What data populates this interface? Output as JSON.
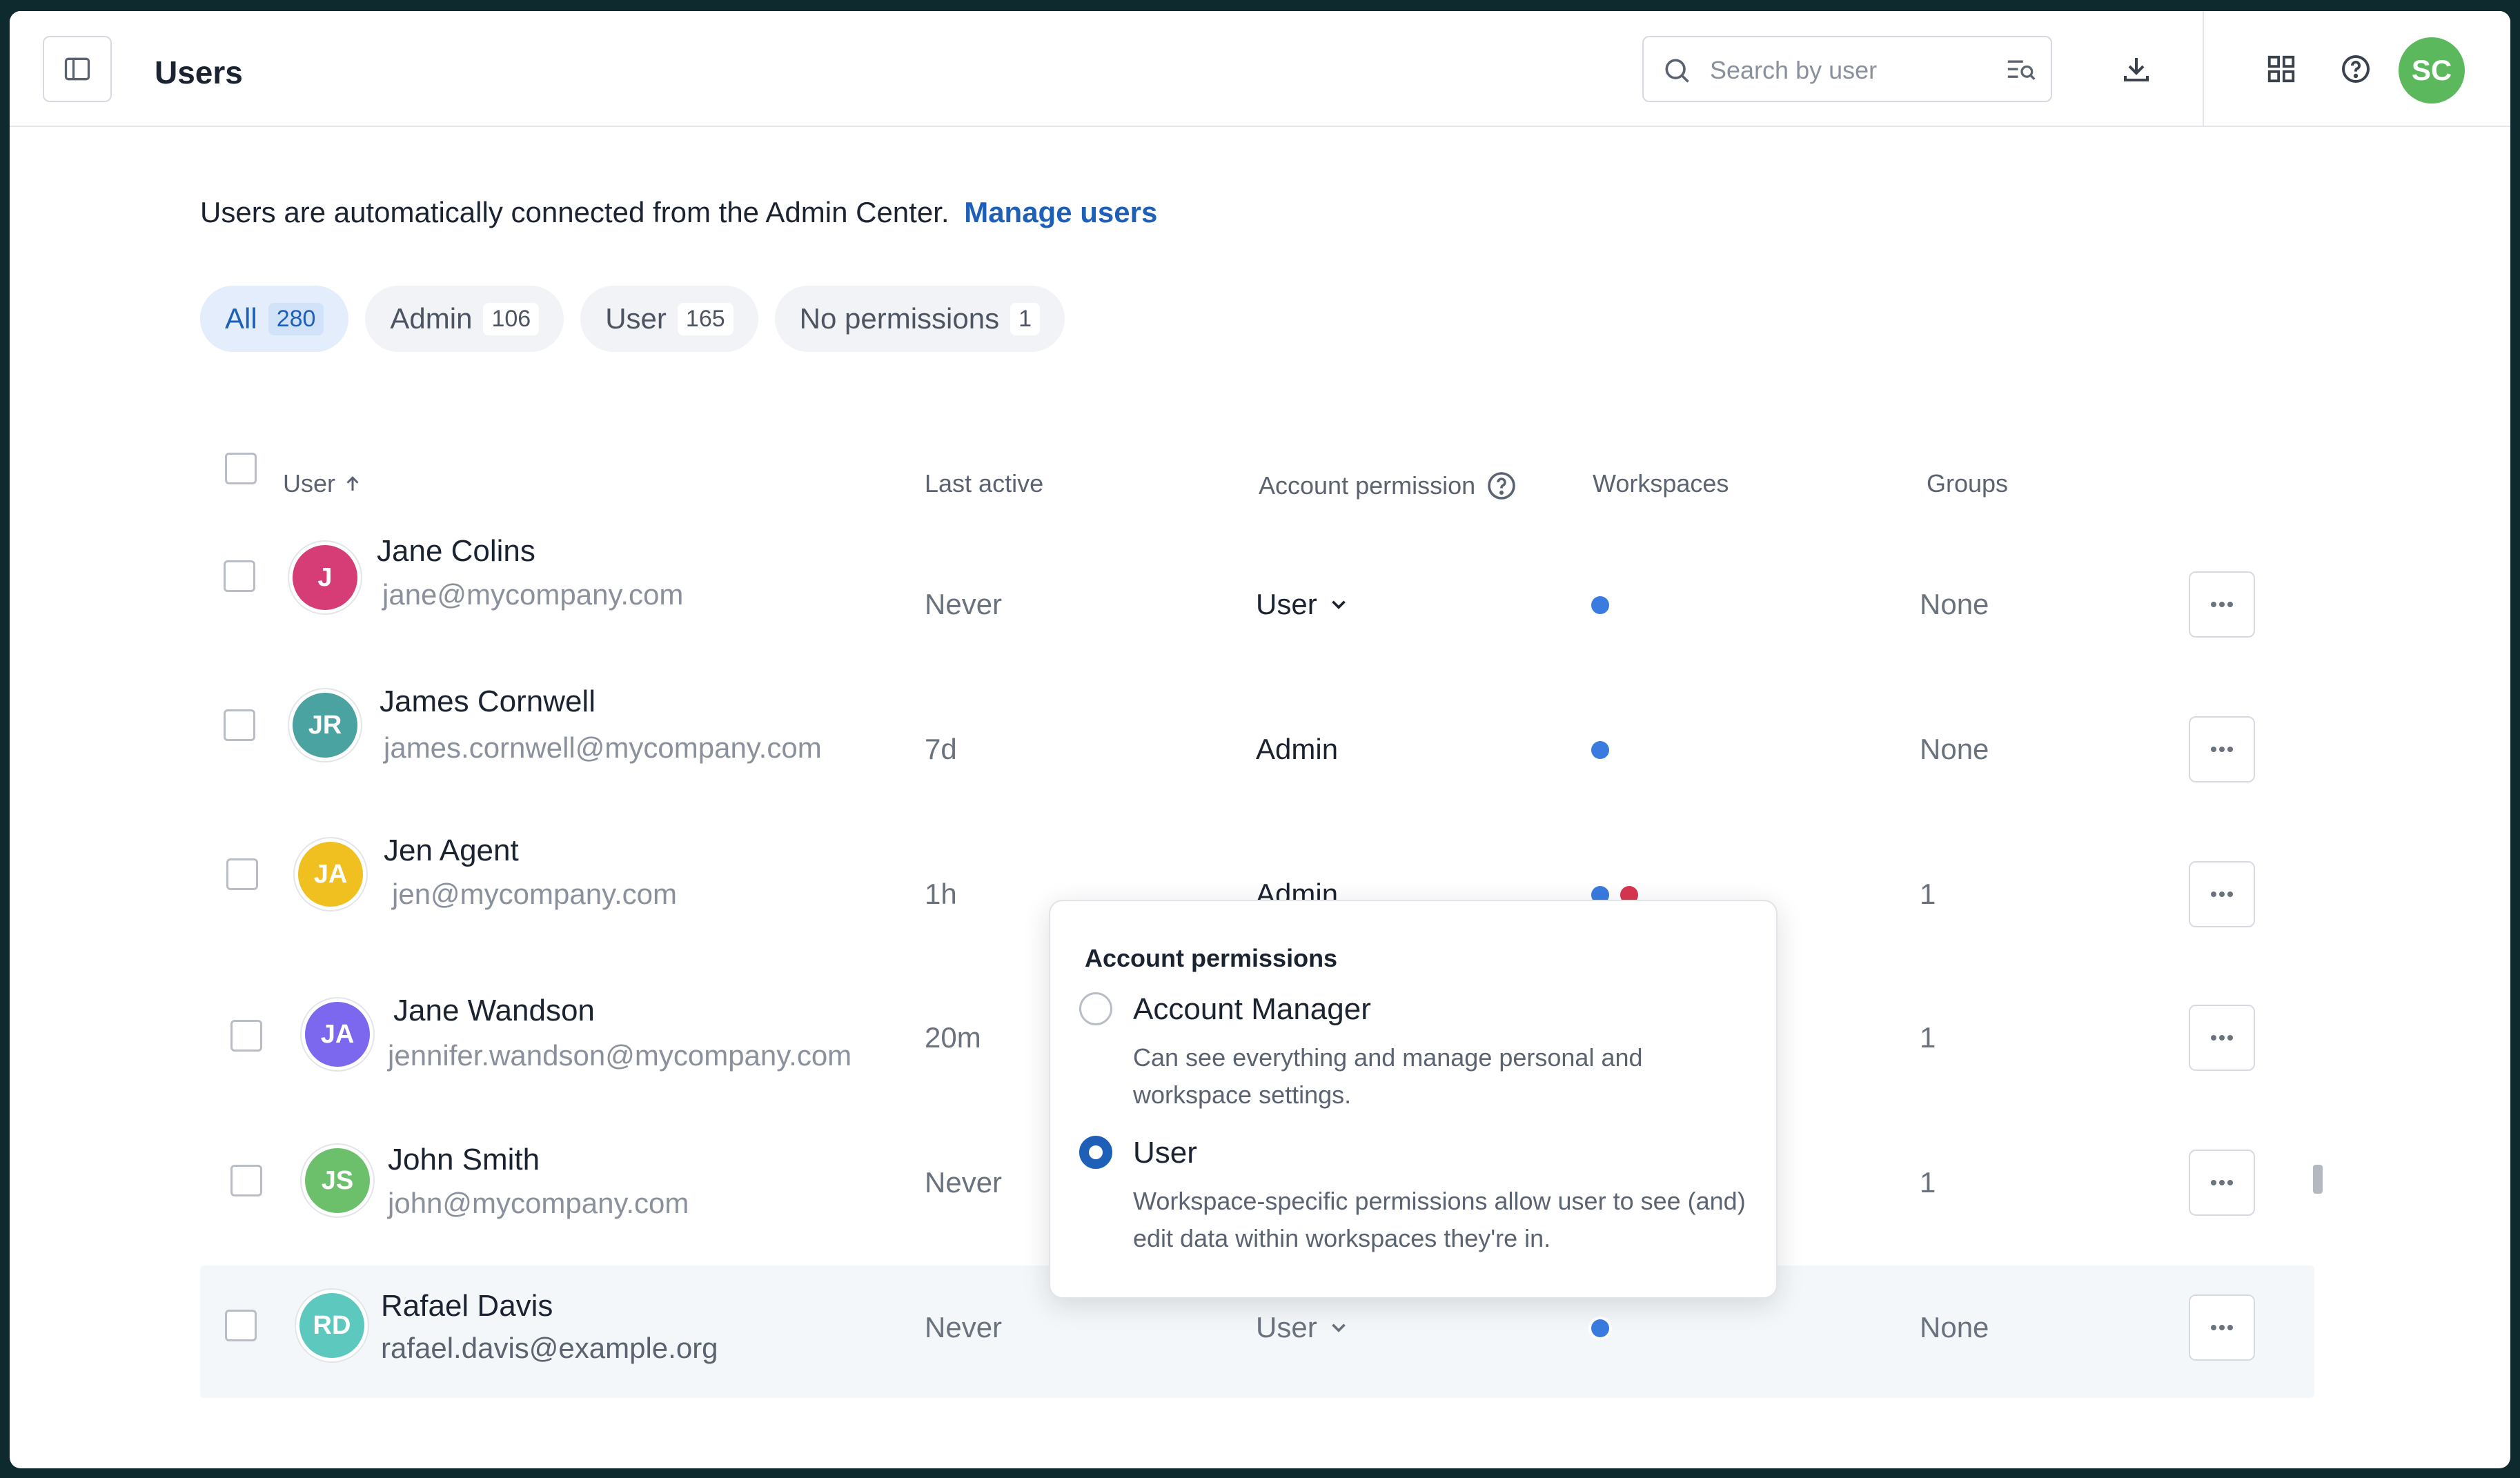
{
  "header": {
    "title": "Users",
    "search_placeholder": "Search by user",
    "user_initials": "SC"
  },
  "intro": {
    "text": "Users are automatically connected from the Admin Center.",
    "link": "Manage users"
  },
  "filters": [
    {
      "label": "All",
      "count": "280",
      "active": true
    },
    {
      "label": "Admin",
      "count": "106"
    },
    {
      "label": "User",
      "count": "165"
    },
    {
      "label": "No permissions",
      "count": "1"
    }
  ],
  "table": {
    "columns": {
      "user": "User",
      "last_active": "Last active",
      "account_permission": "Account permission",
      "workspaces": "Workspaces",
      "groups": "Groups"
    },
    "rows": [
      {
        "initials": "J",
        "name": "Jane Colins",
        "email": "jane@mycompany.com",
        "last_active": "Never",
        "permission": "User",
        "groups": "None",
        "avatar_color": "#d63c75"
      },
      {
        "initials": "JR",
        "name": "James Cornwell",
        "email": "james.cornwell@mycompany.com",
        "last_active": "7d",
        "permission": "Admin",
        "groups": "None",
        "avatar_color": "#4aa3a0"
      },
      {
        "initials": "JA",
        "name": "Jen Agent",
        "email": "jen@mycompany.com",
        "last_active": "1h",
        "permission": "Admin",
        "groups": "1",
        "avatar_color": "#f0c020"
      },
      {
        "initials": "JA",
        "name": "Jane Wandson",
        "email": "jennifer.wandson@mycompany.com",
        "last_active": "20m",
        "permission": "",
        "groups": "1",
        "avatar_color": "#7b68ee"
      },
      {
        "initials": "JS",
        "name": "John Smith",
        "email": "john@mycompany.com",
        "last_active": "Never",
        "permission": "",
        "groups": "1",
        "avatar_color": "#6cc06c"
      },
      {
        "initials": "RD",
        "name": "Rafael Davis",
        "email": "rafael.davis@example.org",
        "last_active": "Never",
        "permission": "User",
        "groups": "None",
        "avatar_color": "#5cc8be"
      }
    ]
  },
  "popover": {
    "title": "Account permissions",
    "options": [
      {
        "label": "Account Manager",
        "description": "Can see everything and manage personal and workspace settings.",
        "selected": false
      },
      {
        "label": "User",
        "description": "Workspace-specific permissions allow user to see (and) edit data within workspaces they're in.",
        "selected": true
      }
    ]
  },
  "colors": {
    "accent": "#1e5fb8",
    "workspace_blue": "#3a7be0",
    "workspace_red": "#d8364f"
  }
}
